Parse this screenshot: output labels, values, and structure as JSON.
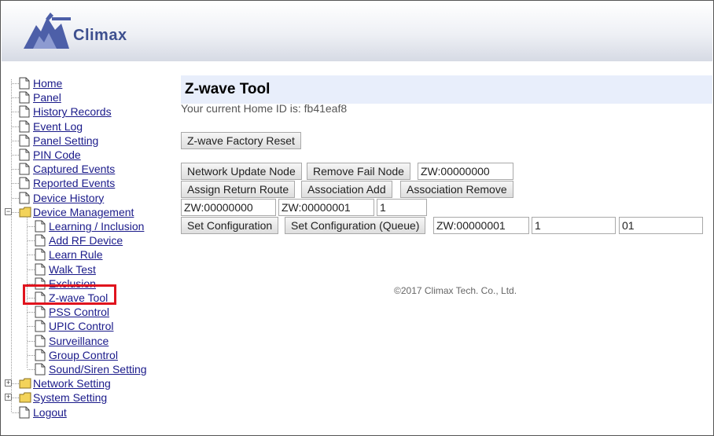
{
  "brand": {
    "name": "Climax"
  },
  "colors": {
    "link": "#1a1a8a",
    "title_bg": "#e8eefb",
    "highlight": "#e0141e"
  },
  "nav": {
    "top": [
      {
        "label": "Home"
      },
      {
        "label": "Panel"
      },
      {
        "label": "History Records"
      },
      {
        "label": "Event Log"
      },
      {
        "label": "Panel Setting"
      },
      {
        "label": "PIN Code"
      },
      {
        "label": "Captured Events"
      },
      {
        "label": "Reported Events"
      },
      {
        "label": "Device History"
      }
    ],
    "device_management": {
      "label": "Device Management",
      "toggle": "−",
      "children": [
        {
          "label": "Learning / Inclusion"
        },
        {
          "label": "Add RF Device"
        },
        {
          "label": "Learn Rule"
        },
        {
          "label": "Walk Test"
        },
        {
          "label": "Exclusion"
        },
        {
          "label": "Z-wave Tool"
        },
        {
          "label": "PSS Control"
        },
        {
          "label": "UPIC Control"
        },
        {
          "label": "Surveillance"
        },
        {
          "label": "Group Control"
        },
        {
          "label": "Sound/Siren Setting"
        }
      ]
    },
    "network_setting": {
      "label": "Network Setting",
      "toggle": "+"
    },
    "system_setting": {
      "label": "System Setting",
      "toggle": "+"
    },
    "logout": {
      "label": "Logout"
    }
  },
  "main": {
    "title": "Z-wave Tool",
    "home_id": "Your current Home ID is: fb41eaf8",
    "factory_reset": "Z-wave Factory Reset",
    "row1": {
      "update": "Network Update Node",
      "remove_fail": "Remove Fail Node",
      "node": "ZW:00000000"
    },
    "row2": {
      "assign": "Assign Return Route",
      "assoc_add": "Association Add",
      "assoc_remove": "Association Remove"
    },
    "row3": {
      "node1": "ZW:00000000",
      "node2": "ZW:00000001",
      "group": "1"
    },
    "row4": {
      "set_config": "Set Configuration",
      "set_config_queue": "Set Configuration (Queue)",
      "node": "ZW:00000001",
      "param": "1",
      "value": "01"
    },
    "footer": "©2017 Climax Tech. Co., Ltd."
  }
}
